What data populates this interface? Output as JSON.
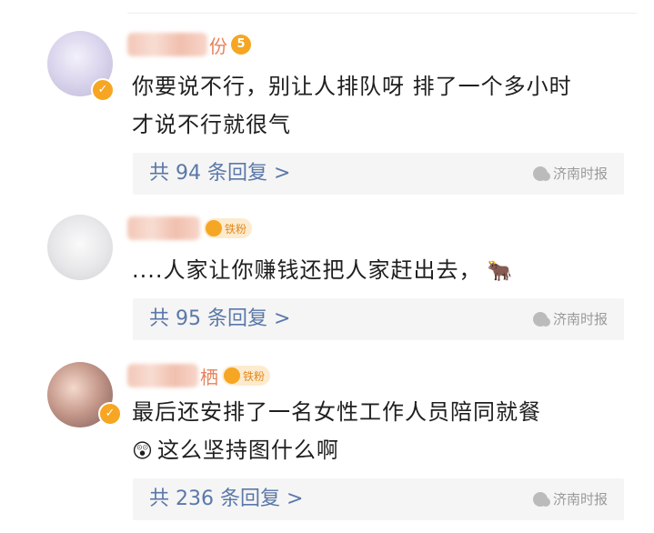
{
  "comments": [
    {
      "name_suffix": "份",
      "text_lines": [
        "你要说不行，别让人排队呀 排了一个多小时",
        "才说不行就很气"
      ],
      "emoji": "",
      "fan_label": "",
      "reply_label": "共 94 条回复 >",
      "watermark": "济南时报"
    },
    {
      "name_suffix": "",
      "text_lines": [
        "....人家让你赚钱还把人家赶出去，"
      ],
      "emoji": "🐂",
      "fan_label": "铁粉",
      "reply_label": "共 95 条回复 >",
      "watermark": "济南时报"
    },
    {
      "name_suffix": "栖",
      "text_lines": [
        "最后还安排了一名女性工作人员陪同就餐",
        "这么坚持图什么啊"
      ],
      "emoji": "😲",
      "fan_label": "铁粉",
      "reply_label": "共 236 条回复 >",
      "watermark": "济南时报"
    }
  ],
  "icons": {
    "verify": "verified-badge-icon",
    "fan": "fan-level-icon",
    "watermark": "wechat-icon"
  },
  "colors": {
    "reply_link": "#5a78a8",
    "name": "#e8815a",
    "badge": "#f5a623"
  }
}
